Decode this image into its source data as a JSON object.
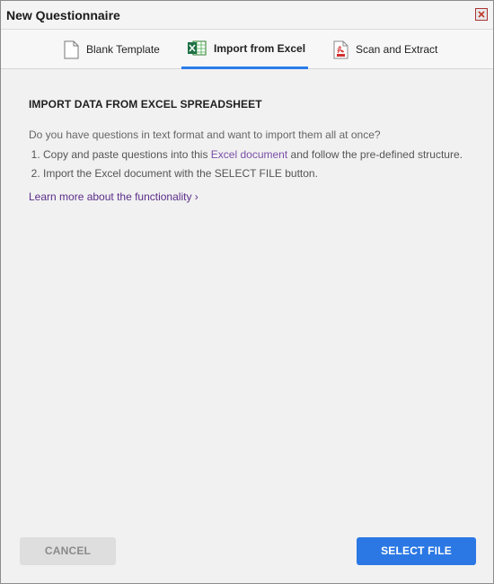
{
  "window": {
    "title": "New Questionnaire"
  },
  "tabs": [
    {
      "label": "Blank Template",
      "icon": "blank-document-icon",
      "active": false
    },
    {
      "label": "Import from Excel",
      "icon": "excel-icon",
      "active": true
    },
    {
      "label": "Scan and Extract",
      "icon": "pdf-icon",
      "active": false
    }
  ],
  "content": {
    "heading": "IMPORT DATA FROM EXCEL SPREADSHEET",
    "intro": "Do you have questions in text format and want to import them all at once?",
    "step1_before": "Copy and paste questions into this ",
    "step1_link": "Excel document",
    "step1_after": " and follow the pre-defined structure.",
    "step2": "Import the Excel document with the SELECT FILE button.",
    "learn_more": "Learn more about the functionality ›"
  },
  "buttons": {
    "cancel": "CANCEL",
    "select_file": "SELECT FILE"
  },
  "colors": {
    "accent": "#2b78e4",
    "link": "#7a4fa8",
    "learn_more": "#5a2d88"
  }
}
